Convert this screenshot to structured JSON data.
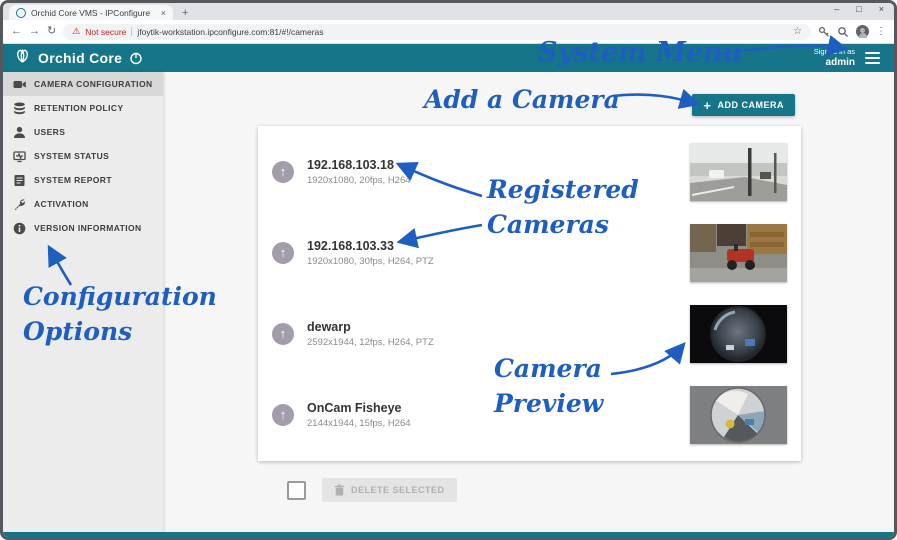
{
  "browser": {
    "tab_title": "Orchid Core VMS - IPConfigure",
    "not_secure": "Not secure",
    "url": "jfoytik-workstation.ipconfigure.com:81/#!/cameras"
  },
  "header": {
    "brand": "Orchid Core",
    "signed_in": "Signed in as",
    "username": "admin"
  },
  "sidebar": {
    "items": [
      {
        "label": "CAMERA CONFIGURATION",
        "icon": "camera-icon",
        "active": true
      },
      {
        "label": "RETENTION POLICY",
        "icon": "retention-icon",
        "active": false
      },
      {
        "label": "USERS",
        "icon": "users-icon",
        "active": false
      },
      {
        "label": "SYSTEM STATUS",
        "icon": "system-status-icon",
        "active": false
      },
      {
        "label": "SYSTEM REPORT",
        "icon": "system-report-icon",
        "active": false
      },
      {
        "label": "ACTIVATION",
        "icon": "activation-icon",
        "active": false
      },
      {
        "label": "VERSION INFORMATION",
        "icon": "version-info-icon",
        "active": false
      }
    ]
  },
  "main": {
    "add_camera_label": "ADD CAMERA",
    "delete_selected_label": "DELETE SELECTED",
    "cameras": [
      {
        "name": "192.168.103.18",
        "details": "1920x1080, 20fps, H264"
      },
      {
        "name": "192.168.103.33",
        "details": "1920x1080, 30fps, H264, PTZ"
      },
      {
        "name": "dewarp",
        "details": "2592x1944, 12fps, H264, PTZ"
      },
      {
        "name": "OnCam Fisheye",
        "details": "2144x1944, 15fps, H264"
      }
    ]
  },
  "annotations": {
    "system_menu": "System Menu",
    "add_a_camera": "Add a Camera",
    "registered_cameras": "Registered\nCameras",
    "camera_preview": "Camera\nPreview",
    "configuration_options": "Configuration\nOptions"
  },
  "icons": {
    "back": "←",
    "forward": "→",
    "refresh": "↻",
    "warning": "⚠",
    "star": "☆",
    "menu": "⋮",
    "close_tab": "×",
    "new_tab": "+",
    "minimize": "–",
    "maximize": "□",
    "close": "×",
    "plus": "+",
    "up_arrow": "↑"
  },
  "colors": {
    "teal": "#17758A",
    "annotation_blue": "#1D5EC0",
    "not_secure_red": "#C5221F",
    "active_sidebar_item": "#D7D7D7"
  }
}
